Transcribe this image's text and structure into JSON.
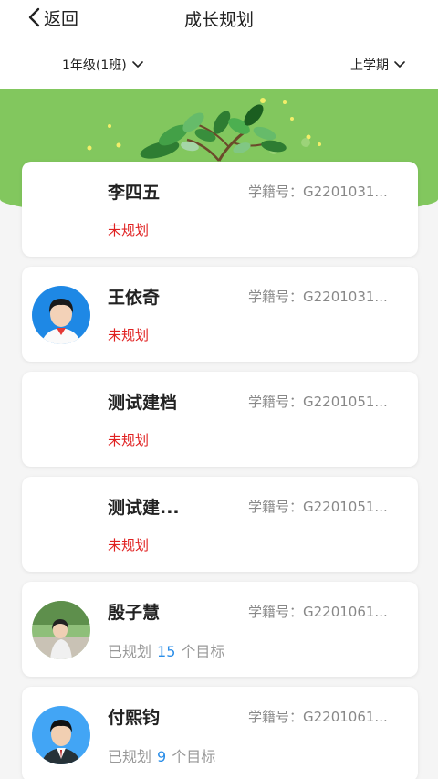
{
  "header": {
    "back_label": "返回",
    "title": "成长规划",
    "grade_filter": "1年级(1班)",
    "term_filter": "上学期"
  },
  "students": [
    {
      "name": "李四五",
      "id_text": "学籍号：G2201031...",
      "status": "未规划",
      "avatar": "none"
    },
    {
      "name": "王依奇",
      "id_text": "学籍号：G2201031...",
      "status": "未规划",
      "avatar": "photo-blue"
    },
    {
      "name": "测试建档",
      "id_text": "学籍号：G2201051...",
      "status": "未规划",
      "avatar": "none"
    },
    {
      "name": "测试建...",
      "id_text": "学籍号：G2201051...",
      "status": "未规划",
      "avatar": "none"
    },
    {
      "name": "殷子慧",
      "id_text": "学籍号：G2201061...",
      "status_prefix": "已规划",
      "count": "15",
      "status_suffix": "个目标",
      "avatar": "photo-outdoor"
    },
    {
      "name": "付熙钧",
      "id_text": "学籍号：G2201061...",
      "status_prefix": "已规划",
      "count": "9",
      "status_suffix": "个目标",
      "avatar": "photo-blue-suit"
    }
  ],
  "colors": {
    "banner_green": "#82c75e",
    "unplanned_red": "#e02020",
    "count_blue": "#2b8ee8"
  },
  "icons": [
    "back-chevron-icon",
    "chevron-down-icon"
  ]
}
